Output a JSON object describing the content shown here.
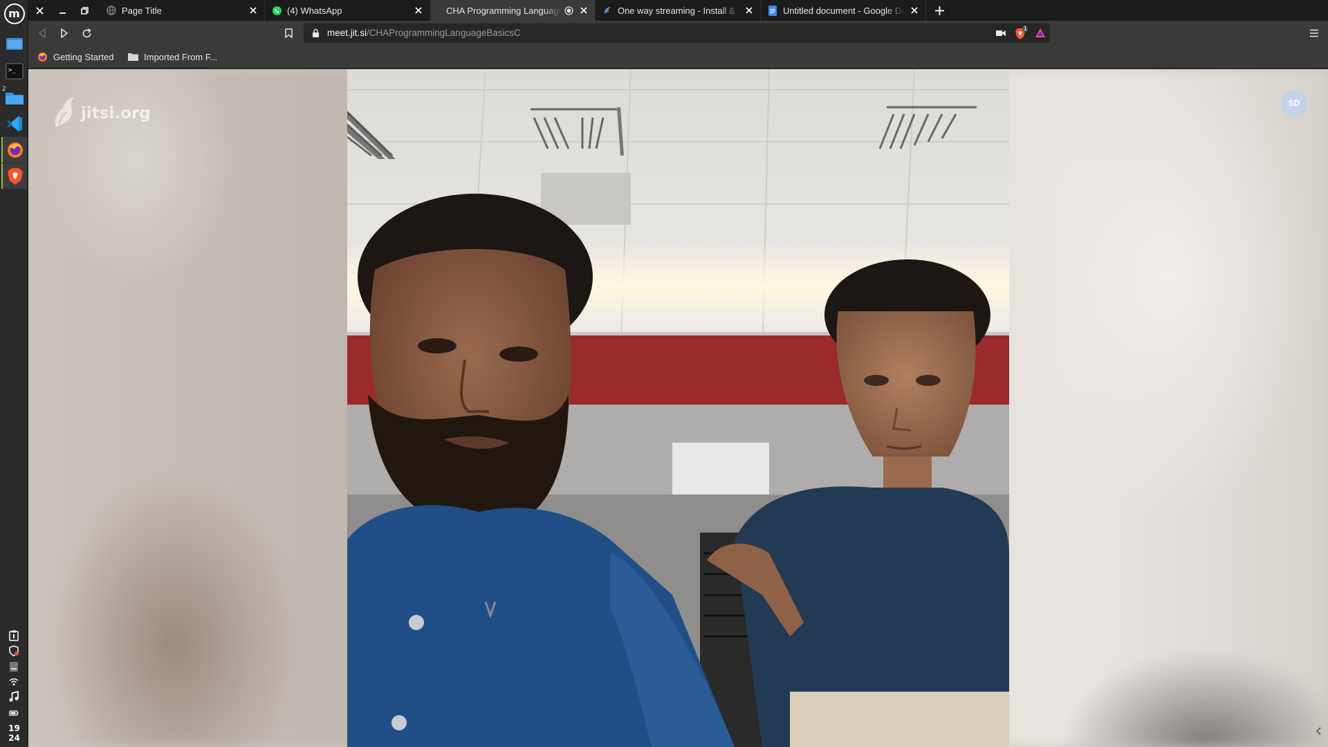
{
  "taskbar": {
    "workspace_number": "2",
    "clock_hour": "19",
    "clock_minute": "24",
    "launchers": [
      "menu-icon",
      "show-desktop-icon",
      "terminal-icon",
      "files-icon",
      "vscode-icon",
      "firefox-icon",
      "brave-icon"
    ],
    "tray": [
      "clipboard-icon",
      "shield-update-icon",
      "drive-icon",
      "wifi-icon",
      "music-icon",
      "battery-icon"
    ]
  },
  "browser": {
    "tabs": [
      {
        "title": "Page Title",
        "icon": "globe-icon",
        "active": false
      },
      {
        "title": "(4) WhatsApp",
        "icon": "whatsapp-icon",
        "active": false
      },
      {
        "title": "CHA Programming Language Basics C",
        "icon": "none",
        "active": true,
        "recording": true
      },
      {
        "title": "One way streaming - Install & Config",
        "icon": "jitsi-icon",
        "active": false
      },
      {
        "title": "Untitled document - Google Docs",
        "icon": "docs-icon",
        "active": false
      }
    ],
    "url": {
      "host": "meet.jit.si",
      "path": "/CHAProgrammingLanguageBasicsC"
    },
    "shields_count": "1",
    "bookmarks": [
      {
        "label": "Getting Started",
        "icon": "firefox-icon"
      },
      {
        "label": "Imported From F...",
        "icon": "folder-icon"
      }
    ]
  },
  "meeting": {
    "watermark": "jitsi.org",
    "participant_initials": "SD",
    "colors": {
      "avatar": "#c3d3ea",
      "shirt_left": "#1f4f86",
      "shirt_right": "#233a55",
      "wall_stripe": "#9a2a2c"
    }
  }
}
